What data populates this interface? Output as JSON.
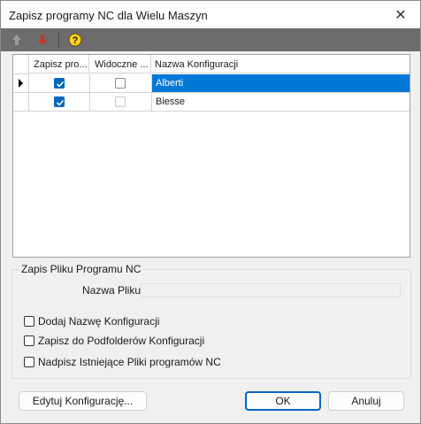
{
  "window": {
    "title": "Zapisz programy NC dla Wielu Maszyn",
    "close_glyph": "✕"
  },
  "toolbar": {
    "icons": [
      "arrow-up-icon",
      "arrow-down-icon",
      "help-icon"
    ]
  },
  "grid": {
    "columns": [
      "Zapisz pro...",
      "Widoczne ...",
      "Nazwa Konfiguracji"
    ],
    "rows": [
      {
        "zapisz": true,
        "widoczne": false,
        "name": "Alberti",
        "selected": true
      },
      {
        "zapisz": true,
        "widoczne": false,
        "name": "Biesse",
        "selected": false
      }
    ]
  },
  "group": {
    "title": "Zapis Pliku Programu NC",
    "file_name_label": "Nazwa Pliku",
    "file_name_value": "",
    "options": [
      {
        "label": "Dodaj Nazwę Konfiguracji",
        "checked": false
      },
      {
        "label": "Zapisz do Podfolderów Konfiguracji",
        "checked": false
      },
      {
        "label": "Nadpisz Istniejące Pliki programów NC",
        "checked": false
      }
    ]
  },
  "buttons": {
    "edit": "Edytuj Konfigurację...",
    "ok": "OK",
    "cancel": "Anuluj"
  },
  "colors": {
    "toolbar": "#6d6d6d",
    "selection": "#0078d7",
    "checkbox_on": "#0067c0"
  }
}
